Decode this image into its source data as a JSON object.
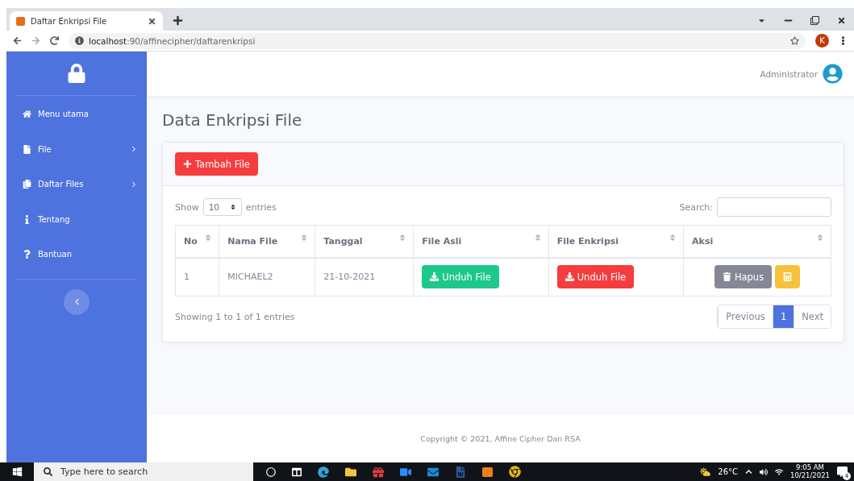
{
  "browser": {
    "tab_title": "Daftar Enkripsi File",
    "url_host": "localhost",
    "url_path": ":90/affinecipher/daftarenkripsi",
    "profile": "K"
  },
  "topbar": {
    "user": "Administrator"
  },
  "sidebar": {
    "items": [
      {
        "label": "Menu utama",
        "kind": "home",
        "expandable": false
      },
      {
        "label": "File",
        "kind": "file",
        "expandable": true
      },
      {
        "label": "Daftar Files",
        "kind": "files",
        "expandable": true
      },
      {
        "label": "Tentang",
        "kind": "info",
        "expandable": false
      },
      {
        "label": "Bantuan",
        "kind": "help",
        "expandable": false
      }
    ]
  },
  "page_title": "Data Enkripsi File",
  "add_button": "Tambah File",
  "table_controls": {
    "show": "Show",
    "page_size": "10",
    "entries": "entries",
    "search_label": "Search:"
  },
  "table": {
    "columns": [
      "No",
      "Nama File",
      "Tanggal",
      "File Asli",
      "File Enkripsi",
      "Aksi"
    ],
    "rows": [
      {
        "no": "1",
        "name": "MICHAEL2",
        "date": "21-10-2021",
        "original": "Unduh File",
        "encrypted": "Unduh File",
        "delete": "Hapus"
      }
    ]
  },
  "info": "Showing 1 to 1 of 1 entries",
  "pagination": [
    {
      "label": "Previous",
      "selected": false
    },
    {
      "label": "1",
      "selected": true
    },
    {
      "label": "Next",
      "selected": false
    }
  ],
  "footer": "Copyright © 2021, Affine Cipher Dan RSA",
  "taskbar": {
    "search_placeholder": "Type here to search",
    "weather": "26°C",
    "time": "9:05 AM",
    "date": "10/21/2021",
    "notifications": "4"
  }
}
